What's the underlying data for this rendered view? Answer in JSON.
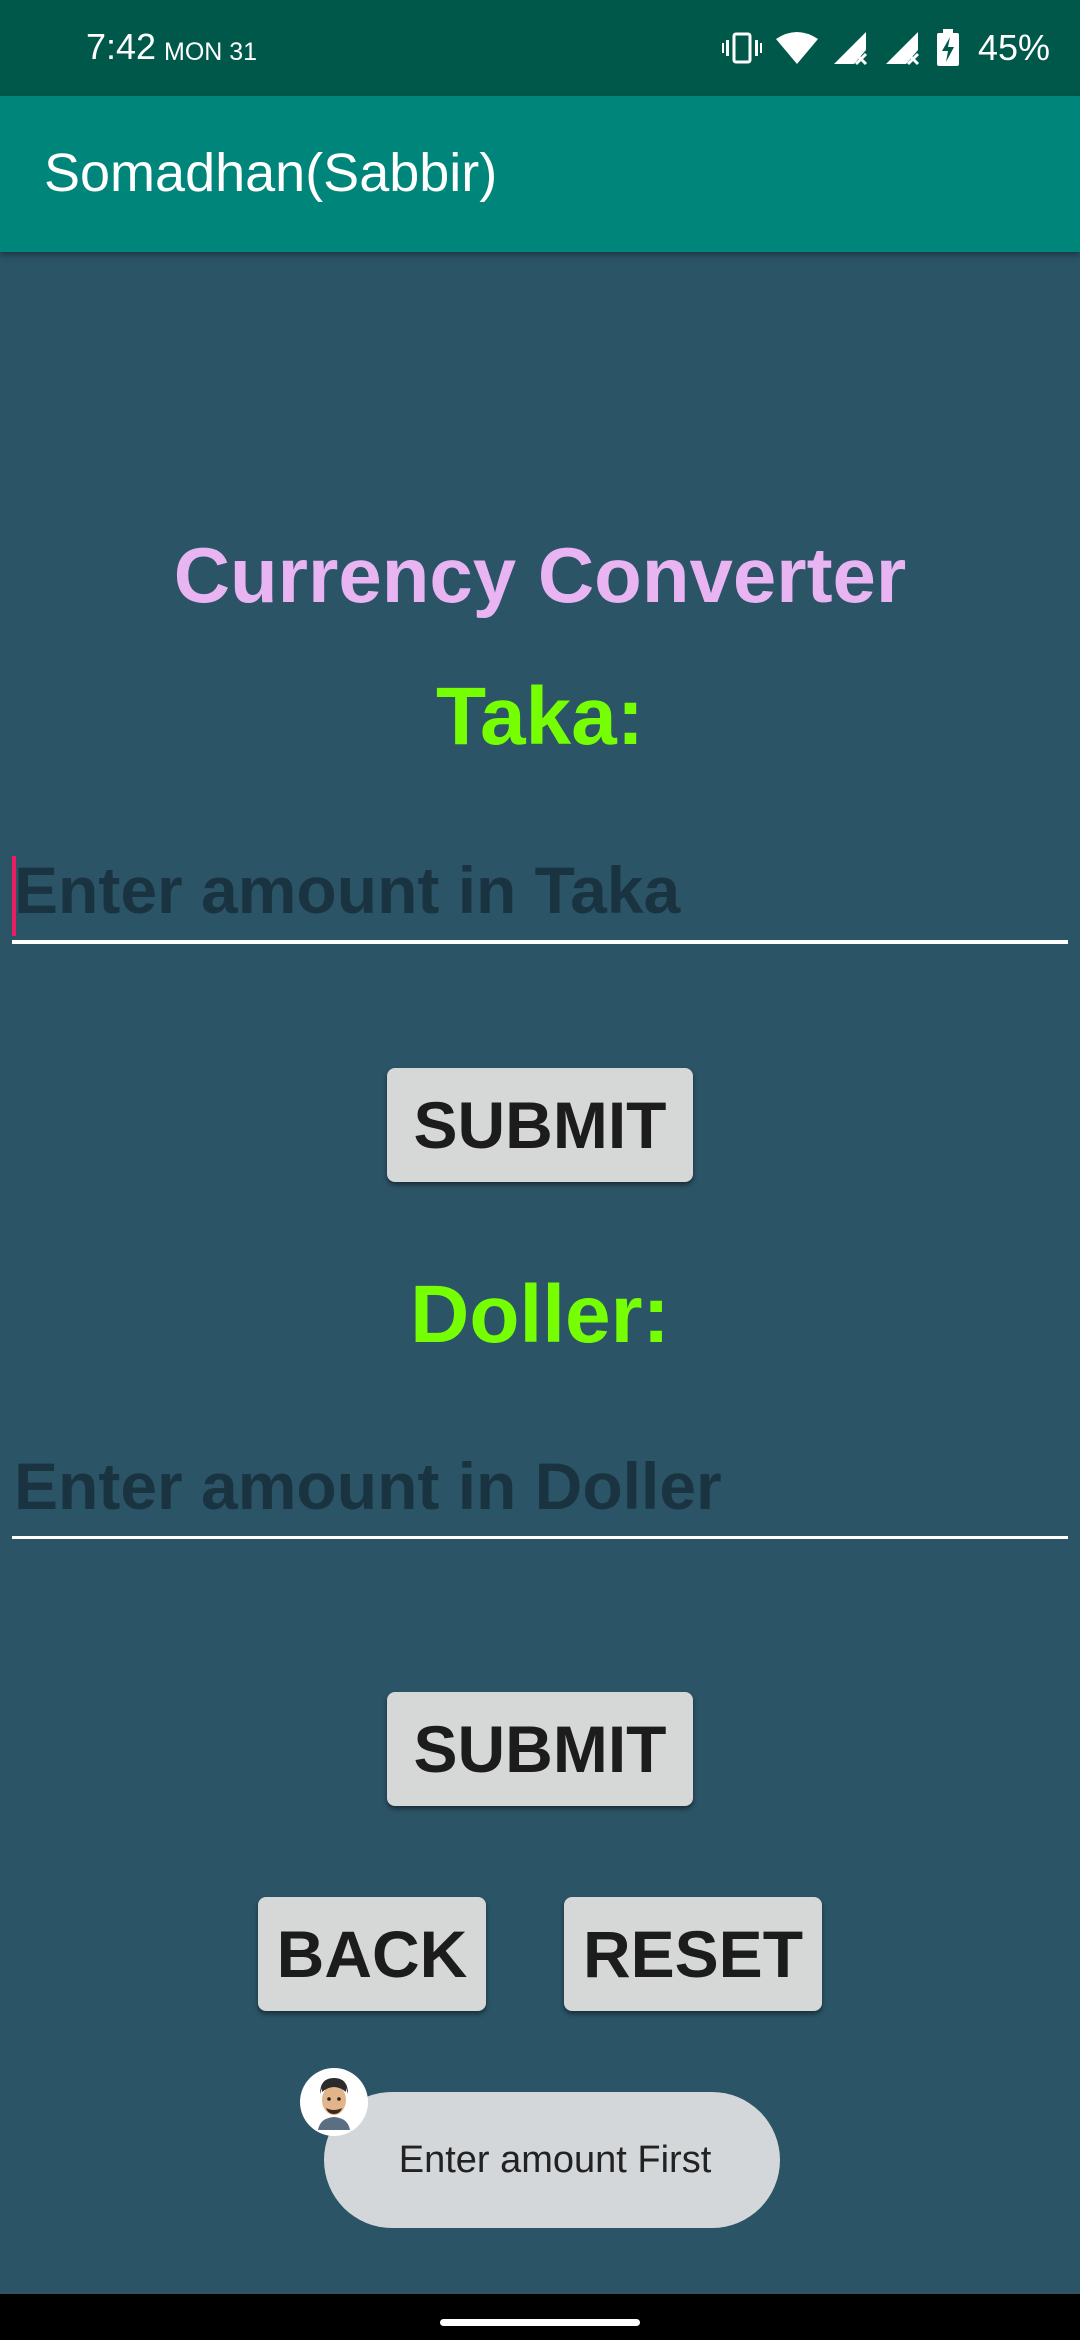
{
  "status_bar": {
    "time": "7:42",
    "day": "MON 31",
    "icons": [
      "vibrate-icon",
      "wifi-icon",
      "signal-icon",
      "signal-icon",
      "battery-charging-icon"
    ],
    "battery": "45%"
  },
  "app_bar": {
    "title": "Somadhan(Sabbir)"
  },
  "main": {
    "title": "Currency Converter",
    "taka_label": "Taka:",
    "taka_placeholder": "Enter amount in Taka",
    "submit_label": "SUBMIT",
    "doller_label": "Doller:",
    "doller_placeholder": "Enter amount in Doller",
    "submit2_label": "SUBMIT",
    "back_label": "BACK",
    "reset_label": "RESET"
  },
  "toast": {
    "message": "Enter amount First"
  },
  "colors": {
    "background": "#2b5467",
    "status_bar": "#00584a",
    "app_bar": "#00857a",
    "title": "#e8b4f2",
    "labels": "#76ff03",
    "button": "#d6d7d7",
    "cursor": "#e91e63"
  }
}
